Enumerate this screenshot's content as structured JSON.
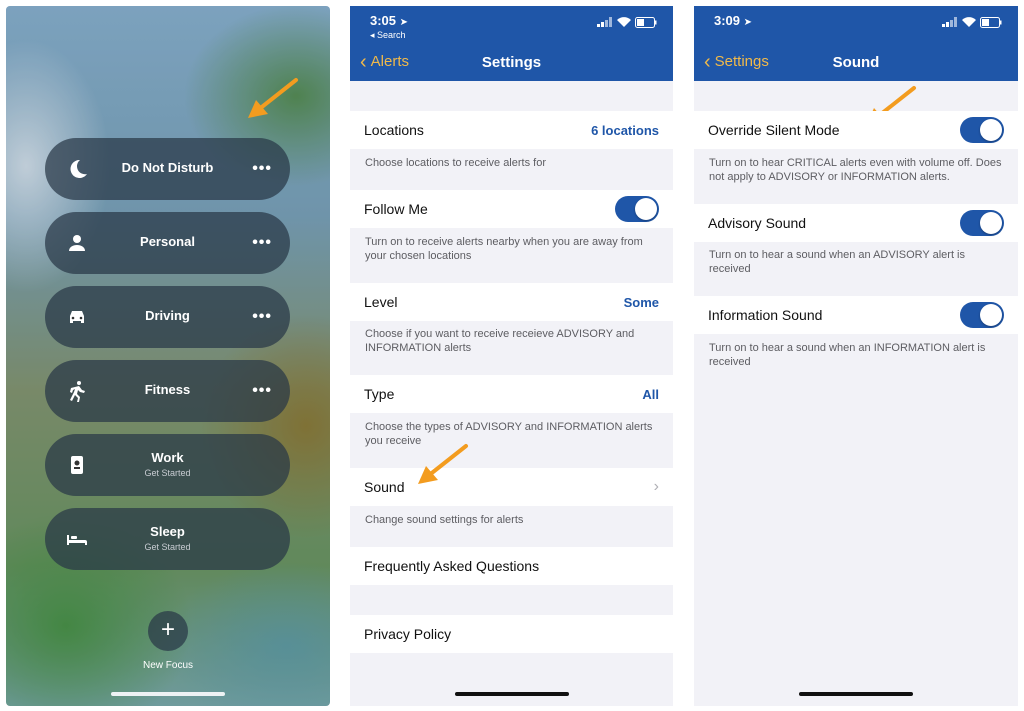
{
  "focus_panel": {
    "items": [
      {
        "label": "Do Not Disturb",
        "icon": "moon-icon",
        "has_more": true
      },
      {
        "label": "Personal",
        "icon": "person-icon",
        "has_more": true
      },
      {
        "label": "Driving",
        "icon": "car-icon",
        "has_more": true
      },
      {
        "label": "Fitness",
        "icon": "running-icon",
        "has_more": true
      },
      {
        "label": "Work",
        "sublabel": "Get Started",
        "icon": "badge-icon"
      },
      {
        "label": "Sleep",
        "sublabel": "Get Started",
        "icon": "bed-icon"
      }
    ],
    "more_label": "•••",
    "new_focus_button": "+",
    "new_focus_label": "New Focus"
  },
  "settings_screen": {
    "status": {
      "time": "3:05",
      "back_app": "◂ Search"
    },
    "nav": {
      "back_label": "Alerts",
      "title": "Settings"
    },
    "rows": [
      {
        "label": "Locations",
        "value": "6 locations",
        "description": "Choose locations to receive alerts for"
      },
      {
        "label": "Follow Me",
        "toggle": true,
        "description": "Turn on to receive alerts nearby when you are away from your chosen locations"
      },
      {
        "label": "Level",
        "value": "Some",
        "description": "Choose if you want to receive receieve ADVISORY and INFORMATION alerts"
      },
      {
        "label": "Type",
        "value": "All",
        "description": "Choose the types of ADVISORY and INFORMATION alerts you receive"
      },
      {
        "label": "Sound",
        "chevron": "›",
        "description": "Change sound settings for alerts"
      },
      {
        "label": "Frequently Asked Questions"
      },
      {
        "label": "Privacy Policy"
      }
    ]
  },
  "sound_screen": {
    "status": {
      "time": "3:09"
    },
    "nav": {
      "back_label": "Settings",
      "title": "Sound"
    },
    "rows": [
      {
        "label": "Override Silent Mode",
        "toggle": true,
        "description": "Turn on to hear CRITICAL alerts even with volume off. Does not apply to ADVISORY or INFORMATION alerts."
      },
      {
        "label": "Advisory Sound",
        "toggle": true,
        "description": "Turn on to hear a sound when an ADVISORY alert is received"
      },
      {
        "label": "Information Sound",
        "toggle": true,
        "description": "Turn on to hear a sound when an INFORMATION alert is received"
      }
    ]
  },
  "colors": {
    "header_blue": "#1f56a8",
    "accent_orange": "#f0b94a",
    "arrow_orange": "#f39c1f"
  }
}
